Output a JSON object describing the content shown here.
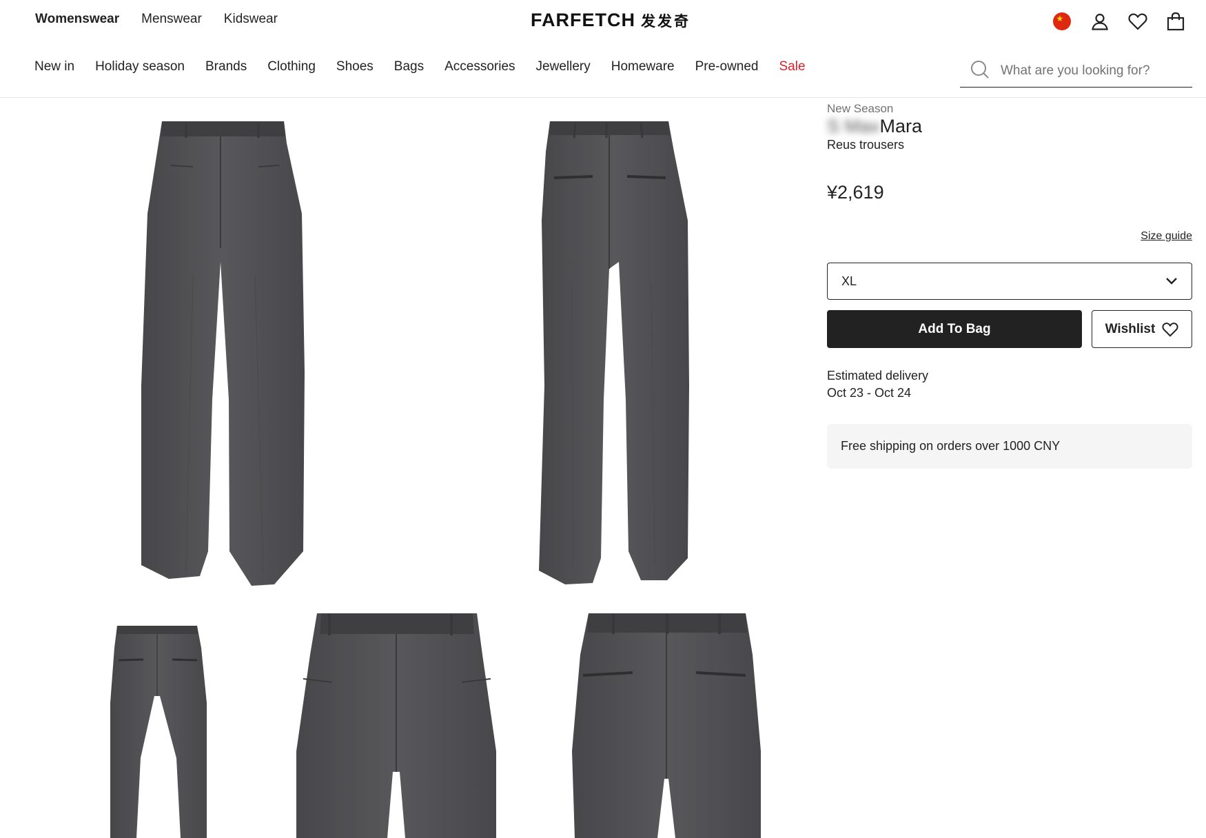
{
  "header": {
    "gender_tabs": [
      "Womenswear",
      "Menswear",
      "Kidswear"
    ],
    "active_tab": "Womenswear",
    "logo": "FARFETCH",
    "logo_cn": "发发奇",
    "icons": [
      "china-flag-icon",
      "account-icon",
      "wishlist-heart-icon",
      "shopping-bag-icon"
    ]
  },
  "nav": {
    "items": [
      "New in",
      "Holiday season",
      "Brands",
      "Clothing",
      "Shoes",
      "Bags",
      "Accessories",
      "Jewellery",
      "Homeware",
      "Pre-owned",
      "Sale"
    ],
    "sale_color": "#d8232a"
  },
  "search": {
    "placeholder": "What are you looking for?",
    "value": ""
  },
  "gallery": {
    "images": [
      "trousers-front",
      "trousers-back",
      "trousers-back-small",
      "trousers-waist-front-detail",
      "trousers-waist-back-detail"
    ],
    "fabric_color": "#505052"
  },
  "product": {
    "badge": "New Season",
    "brand_obscured": "S Max",
    "brand_visible": "Mara",
    "name": "Reus trousers",
    "price": "¥2,619",
    "size_guide": "Size guide",
    "selected_size": "XL",
    "add_to_bag": "Add To Bag",
    "wishlist": "Wishlist",
    "delivery_label": "Estimated delivery",
    "delivery_dates": "Oct 23 - Oct 24",
    "shipping_note": "Free shipping on orders over 1000 CNY"
  },
  "colors": {
    "primary_button": "#222222",
    "text": "#222222",
    "muted_text": "#727272",
    "info_box": "#f5f5f5"
  }
}
